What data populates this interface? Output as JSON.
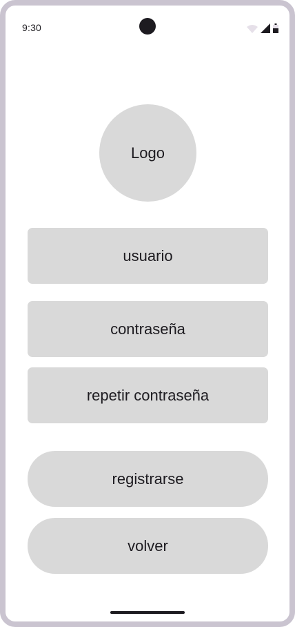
{
  "status_bar": {
    "time": "9:30",
    "icons": [
      "wifi-icon",
      "signal-icon",
      "battery-icon"
    ]
  },
  "logo": {
    "label": "Logo"
  },
  "form": {
    "username_placeholder": "usuario",
    "password_placeholder": "contraseña",
    "repeat_password_placeholder": "repetir contraseña"
  },
  "actions": {
    "register_label": "registrarse",
    "back_label": "volver"
  },
  "colors": {
    "frame": "#cac4d0",
    "surface": "#d9d9d9",
    "text": "#1d1b20"
  }
}
